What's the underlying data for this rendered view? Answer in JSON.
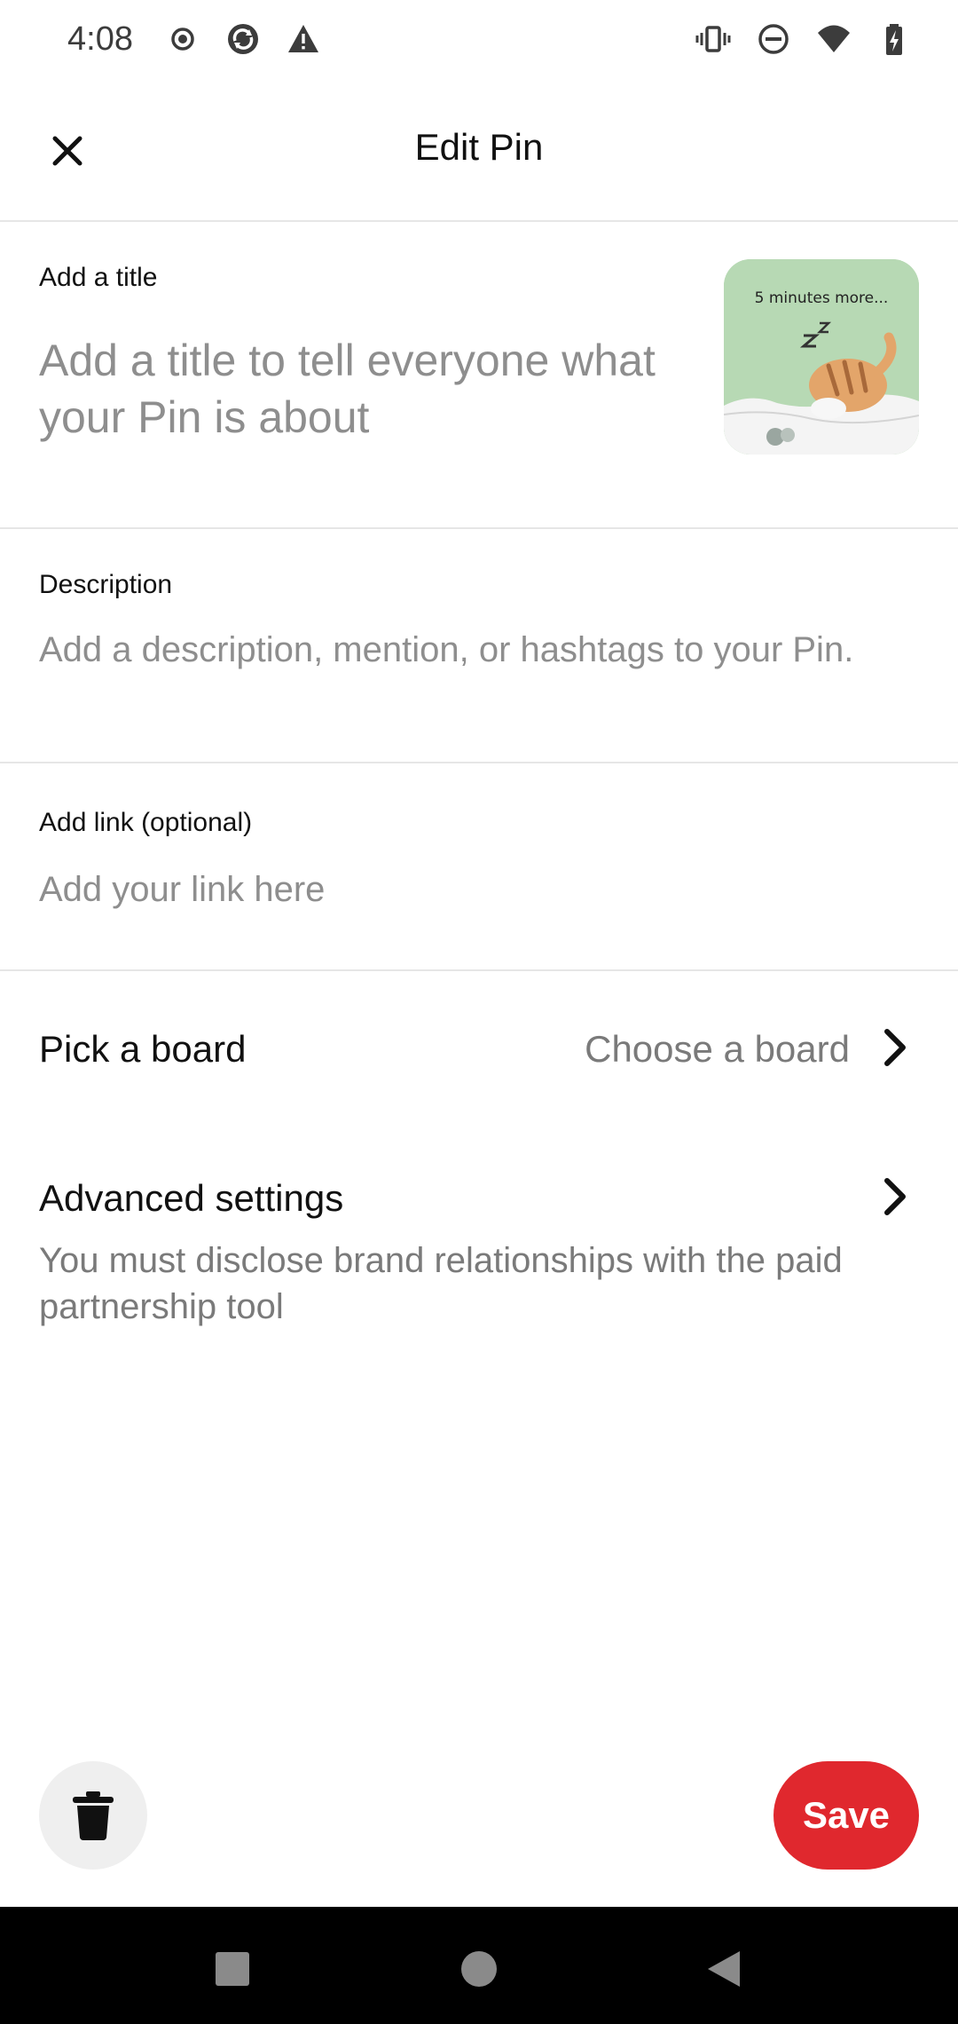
{
  "status_bar": {
    "time": "4:08",
    "left_icons": [
      "record-icon",
      "sync-icon",
      "warning-icon"
    ],
    "right_icons": [
      "vibrate-icon",
      "dnd-icon",
      "wifi-icon",
      "battery-charging-icon"
    ]
  },
  "header": {
    "title": "Edit Pin",
    "close_icon": "close-icon"
  },
  "title_field": {
    "label": "Add a title",
    "placeholder": "Add a title to tell everyone what your Pin is about",
    "value": ""
  },
  "pin_image": {
    "caption": "5 minutes more..."
  },
  "description_field": {
    "label": "Description",
    "placeholder": "Add a description, mention, or hashtags to your Pin.",
    "value": ""
  },
  "link_field": {
    "label": "Add link (optional)",
    "placeholder": "Add your link here",
    "value": ""
  },
  "board_row": {
    "label": "Pick a board",
    "value": "Choose a board"
  },
  "advanced_row": {
    "label": "Advanced settings",
    "subtitle": "You must disclose brand relationships with the paid partnership tool"
  },
  "actions": {
    "save_label": "Save",
    "delete_icon": "trash-icon"
  },
  "colors": {
    "save_red": "#e0282e",
    "placeholder_gray": "#8e8e8e",
    "divider": "#e6e6e6",
    "thumb_green": "#b7d9b4"
  }
}
